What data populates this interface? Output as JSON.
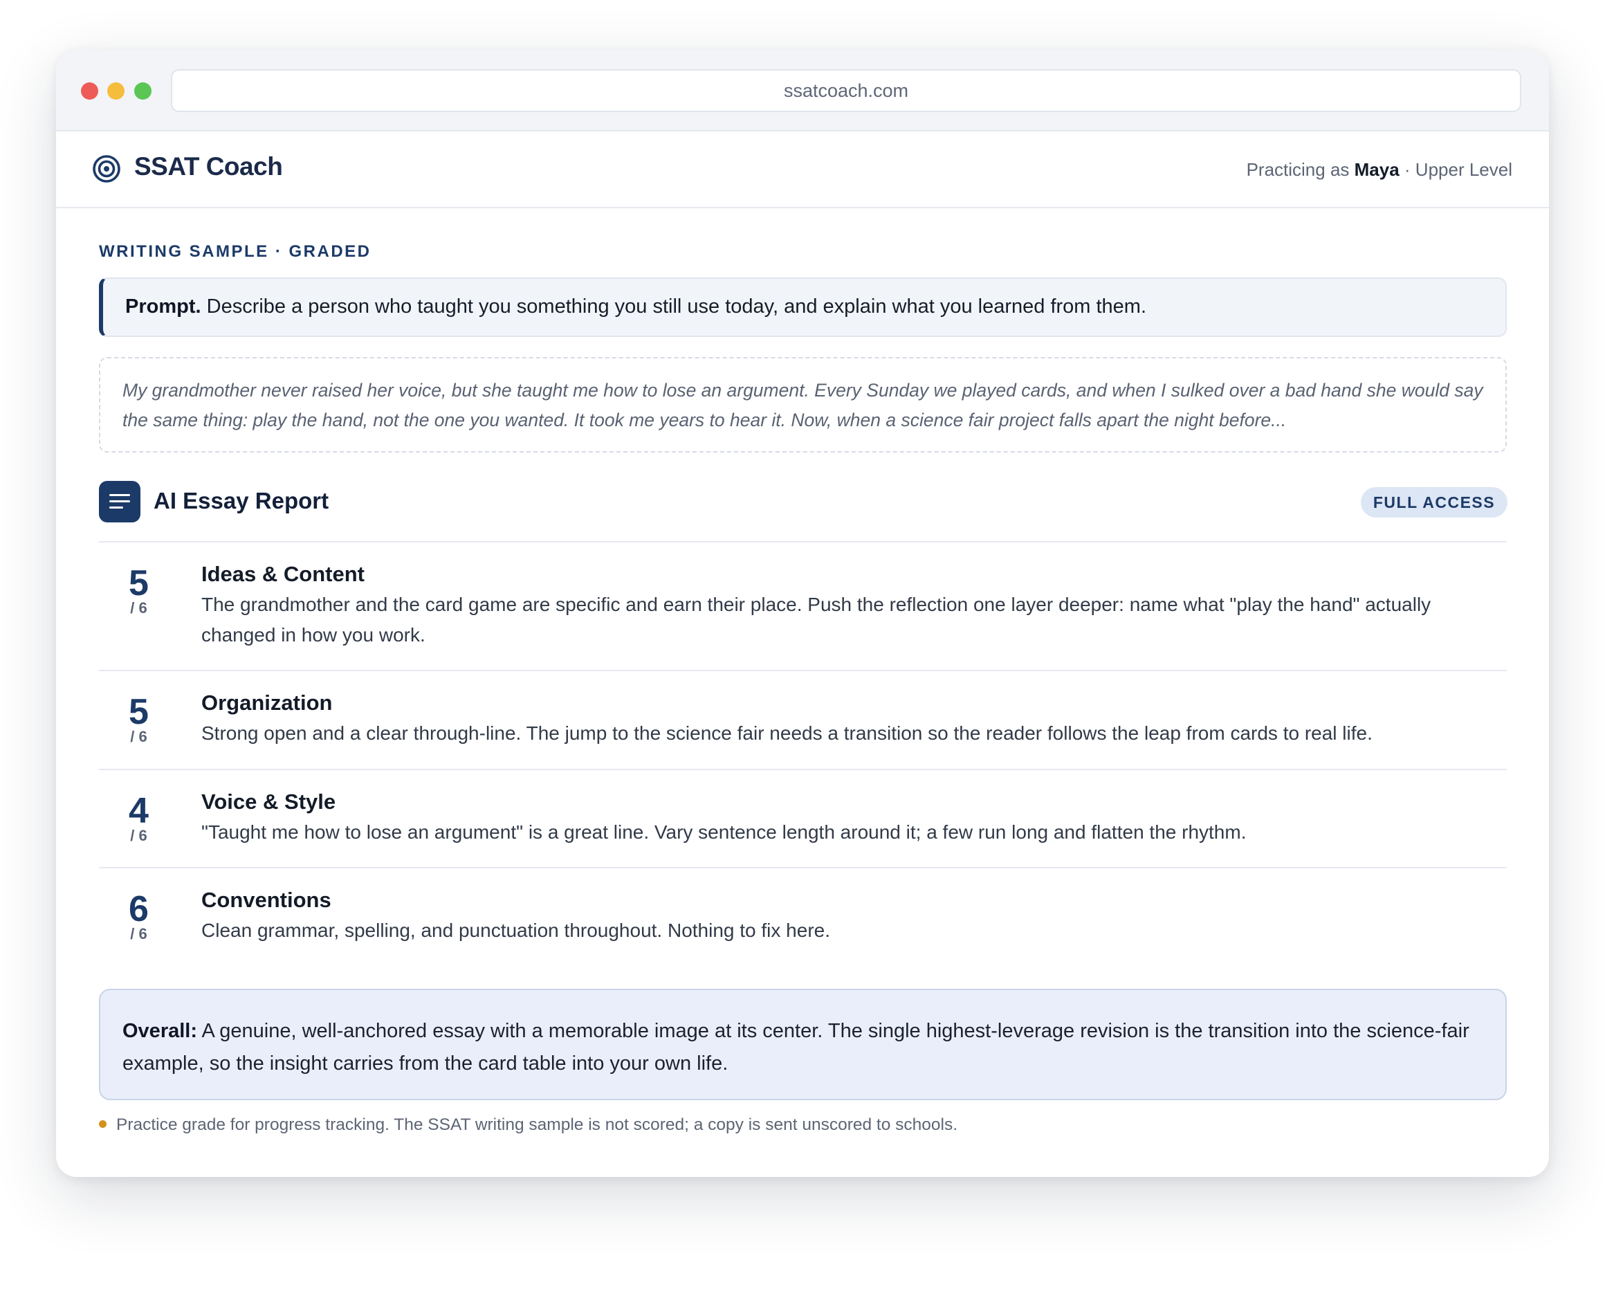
{
  "browser": {
    "url": "ssatcoach.com"
  },
  "header": {
    "brand": "SSAT Coach",
    "practicing_prefix": "Practicing as",
    "user_name": "Maya",
    "level_suffix": "· Upper Level"
  },
  "section_label": "WRITING SAMPLE · GRADED",
  "prompt": {
    "label": "Prompt.",
    "text": "Describe a person who taught you something you still use today, and explain what you learned from them."
  },
  "essay_excerpt": "My grandmother never raised her voice, but she taught me how to lose an argument. Every Sunday we played cards, and when I sulked over a bad hand she would say the same thing: play the hand, not the one you wanted. It took me years to hear it. Now, when a science fair project falls apart the night before...",
  "report": {
    "title": "AI Essay Report",
    "badge": "FULL ACCESS",
    "criteria": [
      {
        "score": "5",
        "max": "/ 6",
        "title": "Ideas & Content",
        "description": "The grandmother and the card game are specific and earn their place. Push the reflection one layer deeper: name what \"play the hand\" actually changed in how you work."
      },
      {
        "score": "5",
        "max": "/ 6",
        "title": "Organization",
        "description": "Strong open and a clear through-line. The jump to the science fair needs a transition so the reader follows the leap from cards to real life."
      },
      {
        "score": "4",
        "max": "/ 6",
        "title": "Voice & Style",
        "description": "\"Taught me how to lose an argument\" is a great line. Vary sentence length around it; a few run long and flatten the rhythm."
      },
      {
        "score": "6",
        "max": "/ 6",
        "title": "Conventions",
        "description": "Clean grammar, spelling, and punctuation throughout. Nothing to fix here."
      }
    ],
    "overall_label": "Overall:",
    "overall_text": "A genuine, well-anchored essay with a memorable image at its center. The single highest-leverage revision is the transition into the science-fair example, so the insight carries from the card table into your own life."
  },
  "footnote": "Practice grade for progress tracking. The SSAT writing sample is not scored; a copy is sent unscored to schools.",
  "colors": {
    "brand_navy": "#1c3a68",
    "footnote_bullet": "#d4921c",
    "overall_bg": "#e9eefa"
  },
  "icons": {
    "brand": "target-icon",
    "report": "document-lines-icon"
  }
}
